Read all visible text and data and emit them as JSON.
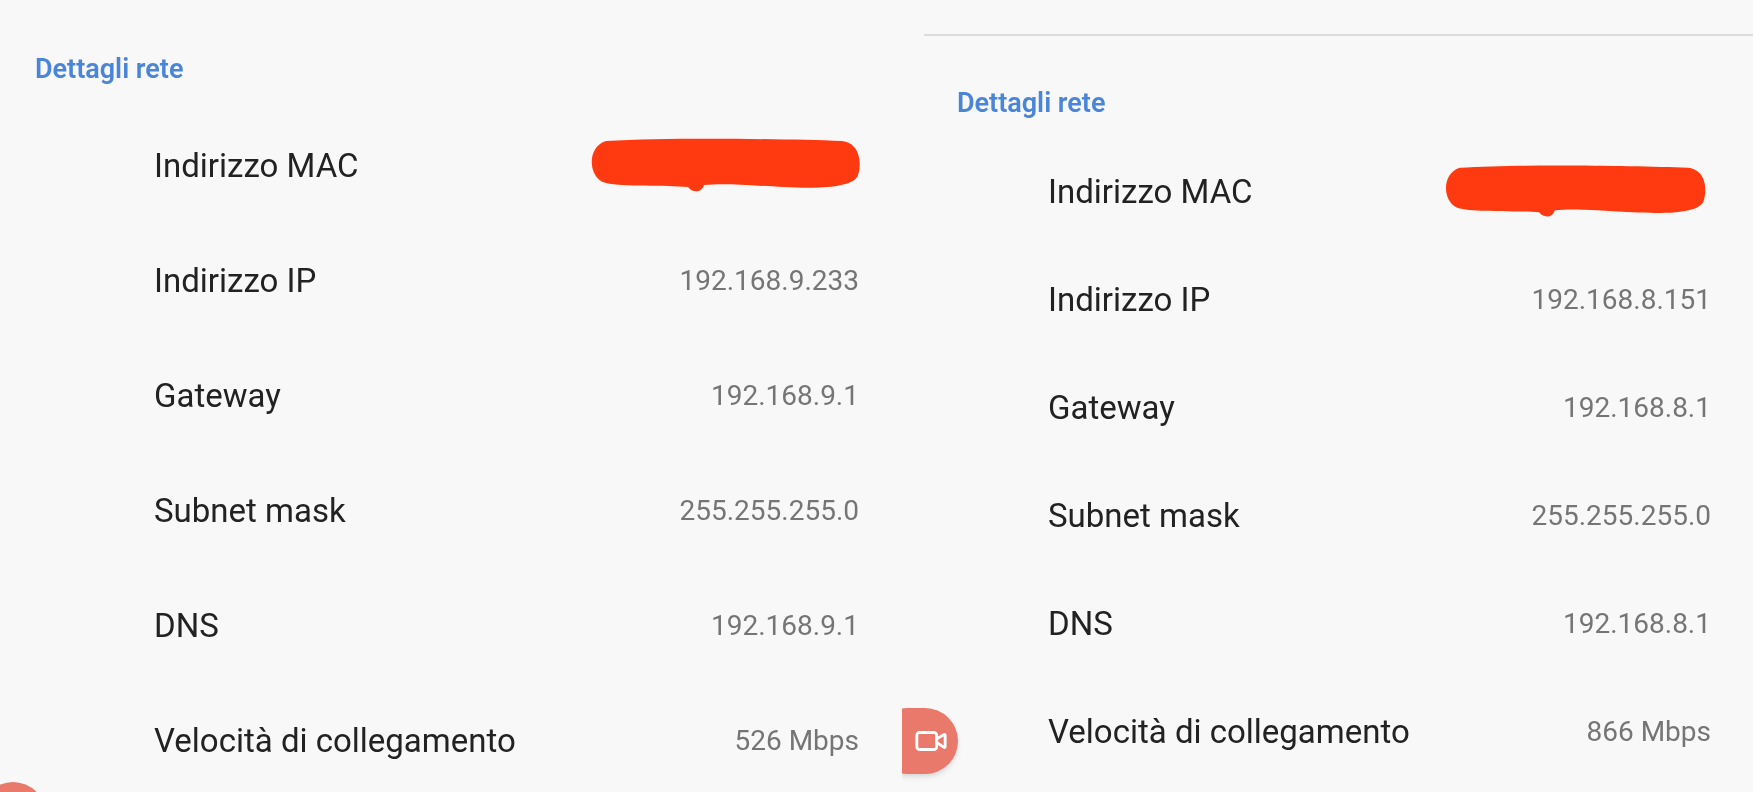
{
  "panels": [
    {
      "top_divider": false,
      "header": "Dettagli rete",
      "rows": [
        {
          "kind": "redacted",
          "label": "Indirizzo MAC"
        },
        {
          "kind": "text",
          "label": "Indirizzo IP",
          "value": "192.168.9.233"
        },
        {
          "kind": "text",
          "label": "Gateway",
          "value": "192.168.9.1"
        },
        {
          "kind": "text",
          "label": "Subnet mask",
          "value": "255.255.255.0"
        },
        {
          "kind": "text",
          "label": "DNS",
          "value": "192.168.9.1"
        },
        {
          "kind": "text",
          "label": "Velocità di collegamento",
          "value": "526 Mbps"
        }
      ]
    },
    {
      "top_divider": true,
      "header": "Dettagli rete",
      "rows": [
        {
          "kind": "redacted",
          "label": "Indirizzo MAC"
        },
        {
          "kind": "text",
          "label": "Indirizzo IP",
          "value": "192.168.8.151"
        },
        {
          "kind": "text",
          "label": "Gateway",
          "value": "192.168.8.1"
        },
        {
          "kind": "text",
          "label": "Subnet mask",
          "value": "255.255.255.0"
        },
        {
          "kind": "text",
          "label": "DNS",
          "value": "192.168.8.1"
        },
        {
          "kind": "text",
          "label": "Velocità di collegamento",
          "value": "866 Mbps"
        }
      ]
    }
  ]
}
